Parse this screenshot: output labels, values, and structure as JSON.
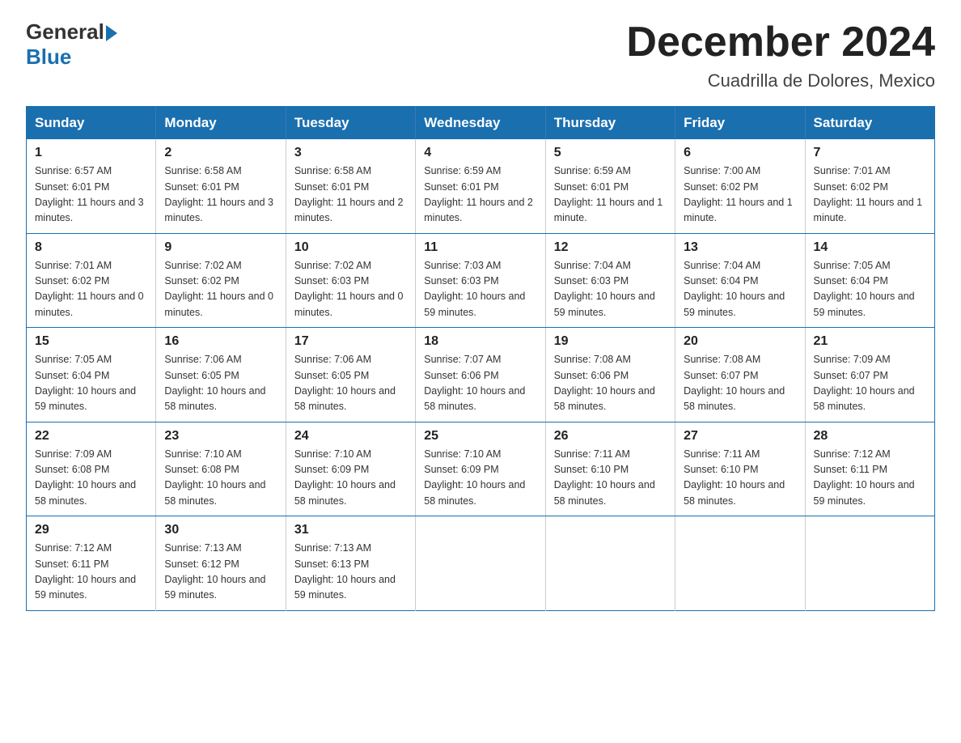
{
  "header": {
    "logo_general": "General",
    "logo_blue": "Blue",
    "month_title": "December 2024",
    "location": "Cuadrilla de Dolores, Mexico"
  },
  "weekdays": [
    "Sunday",
    "Monday",
    "Tuesday",
    "Wednesday",
    "Thursday",
    "Friday",
    "Saturday"
  ],
  "weeks": [
    [
      {
        "day": "1",
        "sunrise": "Sunrise: 6:57 AM",
        "sunset": "Sunset: 6:01 PM",
        "daylight": "Daylight: 11 hours and 3 minutes."
      },
      {
        "day": "2",
        "sunrise": "Sunrise: 6:58 AM",
        "sunset": "Sunset: 6:01 PM",
        "daylight": "Daylight: 11 hours and 3 minutes."
      },
      {
        "day": "3",
        "sunrise": "Sunrise: 6:58 AM",
        "sunset": "Sunset: 6:01 PM",
        "daylight": "Daylight: 11 hours and 2 minutes."
      },
      {
        "day": "4",
        "sunrise": "Sunrise: 6:59 AM",
        "sunset": "Sunset: 6:01 PM",
        "daylight": "Daylight: 11 hours and 2 minutes."
      },
      {
        "day": "5",
        "sunrise": "Sunrise: 6:59 AM",
        "sunset": "Sunset: 6:01 PM",
        "daylight": "Daylight: 11 hours and 1 minute."
      },
      {
        "day": "6",
        "sunrise": "Sunrise: 7:00 AM",
        "sunset": "Sunset: 6:02 PM",
        "daylight": "Daylight: 11 hours and 1 minute."
      },
      {
        "day": "7",
        "sunrise": "Sunrise: 7:01 AM",
        "sunset": "Sunset: 6:02 PM",
        "daylight": "Daylight: 11 hours and 1 minute."
      }
    ],
    [
      {
        "day": "8",
        "sunrise": "Sunrise: 7:01 AM",
        "sunset": "Sunset: 6:02 PM",
        "daylight": "Daylight: 11 hours and 0 minutes."
      },
      {
        "day": "9",
        "sunrise": "Sunrise: 7:02 AM",
        "sunset": "Sunset: 6:02 PM",
        "daylight": "Daylight: 11 hours and 0 minutes."
      },
      {
        "day": "10",
        "sunrise": "Sunrise: 7:02 AM",
        "sunset": "Sunset: 6:03 PM",
        "daylight": "Daylight: 11 hours and 0 minutes."
      },
      {
        "day": "11",
        "sunrise": "Sunrise: 7:03 AM",
        "sunset": "Sunset: 6:03 PM",
        "daylight": "Daylight: 10 hours and 59 minutes."
      },
      {
        "day": "12",
        "sunrise": "Sunrise: 7:04 AM",
        "sunset": "Sunset: 6:03 PM",
        "daylight": "Daylight: 10 hours and 59 minutes."
      },
      {
        "day": "13",
        "sunrise": "Sunrise: 7:04 AM",
        "sunset": "Sunset: 6:04 PM",
        "daylight": "Daylight: 10 hours and 59 minutes."
      },
      {
        "day": "14",
        "sunrise": "Sunrise: 7:05 AM",
        "sunset": "Sunset: 6:04 PM",
        "daylight": "Daylight: 10 hours and 59 minutes."
      }
    ],
    [
      {
        "day": "15",
        "sunrise": "Sunrise: 7:05 AM",
        "sunset": "Sunset: 6:04 PM",
        "daylight": "Daylight: 10 hours and 59 minutes."
      },
      {
        "day": "16",
        "sunrise": "Sunrise: 7:06 AM",
        "sunset": "Sunset: 6:05 PM",
        "daylight": "Daylight: 10 hours and 58 minutes."
      },
      {
        "day": "17",
        "sunrise": "Sunrise: 7:06 AM",
        "sunset": "Sunset: 6:05 PM",
        "daylight": "Daylight: 10 hours and 58 minutes."
      },
      {
        "day": "18",
        "sunrise": "Sunrise: 7:07 AM",
        "sunset": "Sunset: 6:06 PM",
        "daylight": "Daylight: 10 hours and 58 minutes."
      },
      {
        "day": "19",
        "sunrise": "Sunrise: 7:08 AM",
        "sunset": "Sunset: 6:06 PM",
        "daylight": "Daylight: 10 hours and 58 minutes."
      },
      {
        "day": "20",
        "sunrise": "Sunrise: 7:08 AM",
        "sunset": "Sunset: 6:07 PM",
        "daylight": "Daylight: 10 hours and 58 minutes."
      },
      {
        "day": "21",
        "sunrise": "Sunrise: 7:09 AM",
        "sunset": "Sunset: 6:07 PM",
        "daylight": "Daylight: 10 hours and 58 minutes."
      }
    ],
    [
      {
        "day": "22",
        "sunrise": "Sunrise: 7:09 AM",
        "sunset": "Sunset: 6:08 PM",
        "daylight": "Daylight: 10 hours and 58 minutes."
      },
      {
        "day": "23",
        "sunrise": "Sunrise: 7:10 AM",
        "sunset": "Sunset: 6:08 PM",
        "daylight": "Daylight: 10 hours and 58 minutes."
      },
      {
        "day": "24",
        "sunrise": "Sunrise: 7:10 AM",
        "sunset": "Sunset: 6:09 PM",
        "daylight": "Daylight: 10 hours and 58 minutes."
      },
      {
        "day": "25",
        "sunrise": "Sunrise: 7:10 AM",
        "sunset": "Sunset: 6:09 PM",
        "daylight": "Daylight: 10 hours and 58 minutes."
      },
      {
        "day": "26",
        "sunrise": "Sunrise: 7:11 AM",
        "sunset": "Sunset: 6:10 PM",
        "daylight": "Daylight: 10 hours and 58 minutes."
      },
      {
        "day": "27",
        "sunrise": "Sunrise: 7:11 AM",
        "sunset": "Sunset: 6:10 PM",
        "daylight": "Daylight: 10 hours and 58 minutes."
      },
      {
        "day": "28",
        "sunrise": "Sunrise: 7:12 AM",
        "sunset": "Sunset: 6:11 PM",
        "daylight": "Daylight: 10 hours and 59 minutes."
      }
    ],
    [
      {
        "day": "29",
        "sunrise": "Sunrise: 7:12 AM",
        "sunset": "Sunset: 6:11 PM",
        "daylight": "Daylight: 10 hours and 59 minutes."
      },
      {
        "day": "30",
        "sunrise": "Sunrise: 7:13 AM",
        "sunset": "Sunset: 6:12 PM",
        "daylight": "Daylight: 10 hours and 59 minutes."
      },
      {
        "day": "31",
        "sunrise": "Sunrise: 7:13 AM",
        "sunset": "Sunset: 6:13 PM",
        "daylight": "Daylight: 10 hours and 59 minutes."
      },
      null,
      null,
      null,
      null
    ]
  ]
}
